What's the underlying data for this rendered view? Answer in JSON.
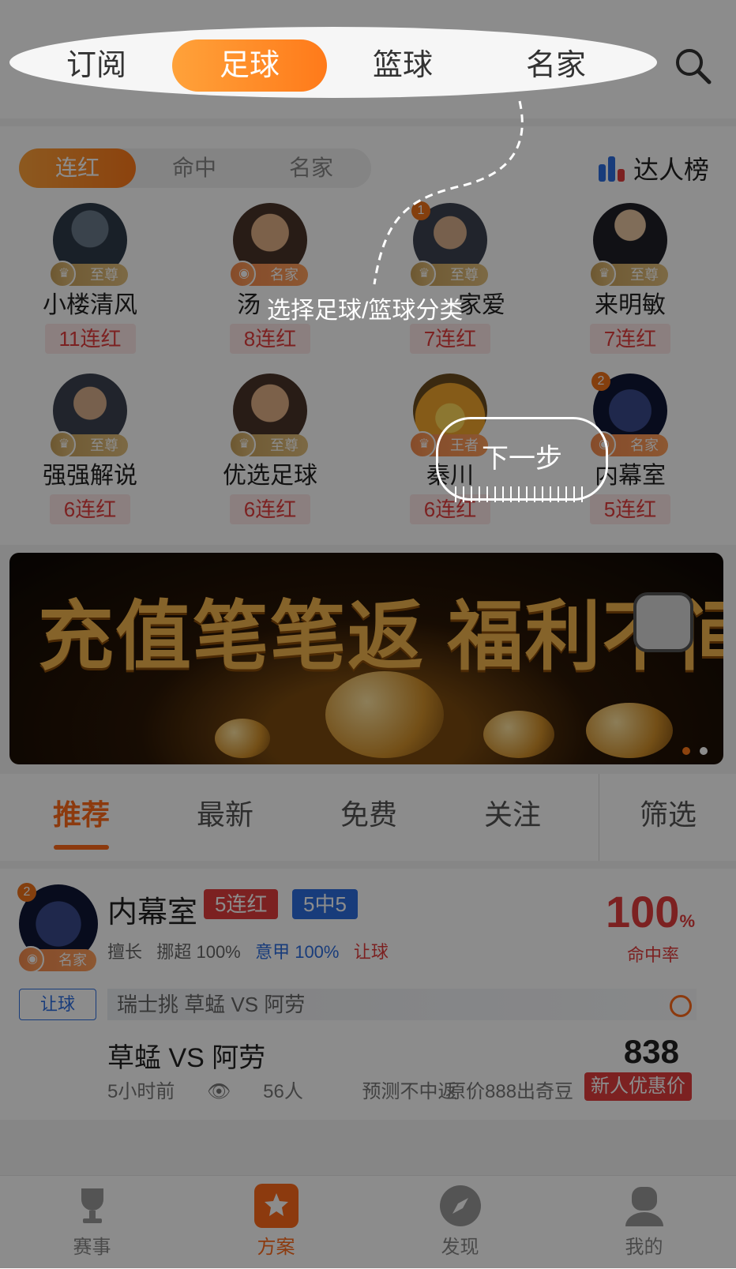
{
  "top_tabs": {
    "items": [
      {
        "label": "订阅"
      },
      {
        "label": "足球"
      },
      {
        "label": "篮球"
      },
      {
        "label": "名家"
      }
    ],
    "active_index": 1,
    "search_icon": "search-icon"
  },
  "leaderboard": {
    "segments": [
      {
        "label": "连红"
      },
      {
        "label": "命中"
      },
      {
        "label": "名家"
      }
    ],
    "active_segment": 0,
    "rank_link": {
      "label": "达人榜",
      "icon": "bar-chart-icon"
    },
    "experts": [
      {
        "name": "小楼清风",
        "badge": "至尊",
        "streak": "11连红"
      },
      {
        "name": "汤",
        "badge": "名家",
        "streak": "8连红"
      },
      {
        "name": "家爱",
        "badge": "至尊",
        "streak": "7连红",
        "rank": "1"
      },
      {
        "name": "来明敏",
        "badge": "至尊",
        "streak": "7连红"
      },
      {
        "name": "强强解说",
        "badge": "至尊",
        "streak": "6连红"
      },
      {
        "name": "优选足球",
        "badge": "至尊",
        "streak": "6连红"
      },
      {
        "name": "秦川",
        "badge": "王者",
        "streak": "6连红"
      },
      {
        "name": "内幕室",
        "badge": "名家",
        "streak": "5连红",
        "rank": "2"
      }
    ]
  },
  "banner": {
    "title": "充值笔笔返 福利不间断",
    "slides": 2,
    "active_slide": 0
  },
  "feed_tabs": {
    "items": [
      {
        "label": "推荐"
      },
      {
        "label": "最新"
      },
      {
        "label": "免费"
      },
      {
        "label": "关注"
      }
    ],
    "active_index": 0,
    "filter_label": "筛选"
  },
  "plan_card": {
    "expert_name": "内幕室",
    "rank": "2",
    "badge": "名家",
    "tag_streak": "5连红",
    "tag_record": "5中5",
    "hit_rate": "100",
    "hit_rate_unit": "%",
    "hit_rate_label": "命中率",
    "speciality_label": "擅长",
    "speciality_1": "挪超 100%",
    "speciality_2": "意甲 100%",
    "speciality_3": "让球",
    "play_type": "让球",
    "league": "瑞士挑 草蜢 VS 阿劳",
    "match": "草蜢 VS 阿劳",
    "price": "838",
    "time": "5小时前",
    "views": "56人",
    "refund_note": "预测不中返",
    "original_price": "原价888出奇豆",
    "promo_tag": "新人优惠价"
  },
  "bottom_nav": {
    "items": [
      {
        "label": "赛事",
        "icon": "trophy-icon"
      },
      {
        "label": "方案",
        "icon": "star-document-icon"
      },
      {
        "label": "发现",
        "icon": "compass-icon"
      },
      {
        "label": "我的",
        "icon": "user-icon"
      }
    ],
    "active_index": 1
  },
  "guide": {
    "hint": "选择足球/篮球分类",
    "next_label": "下一步"
  },
  "colors": {
    "accent": "#ff7a1a",
    "red": "#e23d3d",
    "blue": "#2d6de0"
  }
}
